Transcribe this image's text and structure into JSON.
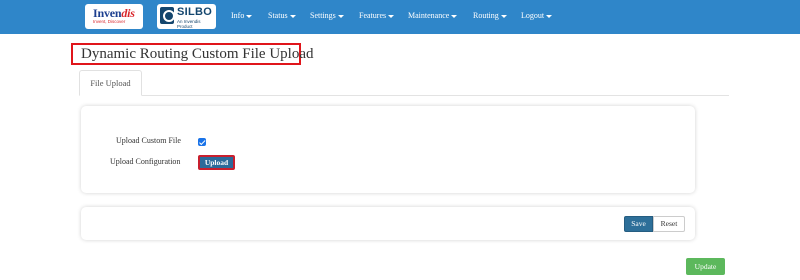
{
  "navbar": {
    "logos": {
      "invendis": {
        "brand_prefix": "Inven",
        "brand_suffix": "dis",
        "tagline": "Invent, Discover"
      },
      "silbo": {
        "brand": "SILBO",
        "tagline": "An Invendis Product"
      }
    },
    "menu": [
      {
        "label": "Info"
      },
      {
        "label": "Status"
      },
      {
        "label": "Settings"
      },
      {
        "label": "Features"
      },
      {
        "label": "Maintenance"
      },
      {
        "label": "Routing"
      },
      {
        "label": "Logout"
      }
    ]
  },
  "page": {
    "title": "Dynamic Routing Custom File Upload"
  },
  "tabs": [
    {
      "label": "File Upload",
      "active": true
    }
  ],
  "form": {
    "upload_custom_file": {
      "label": "Upload Custom File",
      "checked": true
    },
    "upload_configuration": {
      "label": "Upload Configuration",
      "button_label": "Upload"
    }
  },
  "actions": {
    "save_label": "Save",
    "reset_label": "Reset"
  },
  "footer": {
    "update_label": "Update"
  },
  "colors": {
    "navbar": "#2f86c9",
    "highlight_border": "#e0151b",
    "primary_button": "#2d6f99",
    "update_button": "#5cb85c",
    "checkbox": "#1a73e8"
  }
}
